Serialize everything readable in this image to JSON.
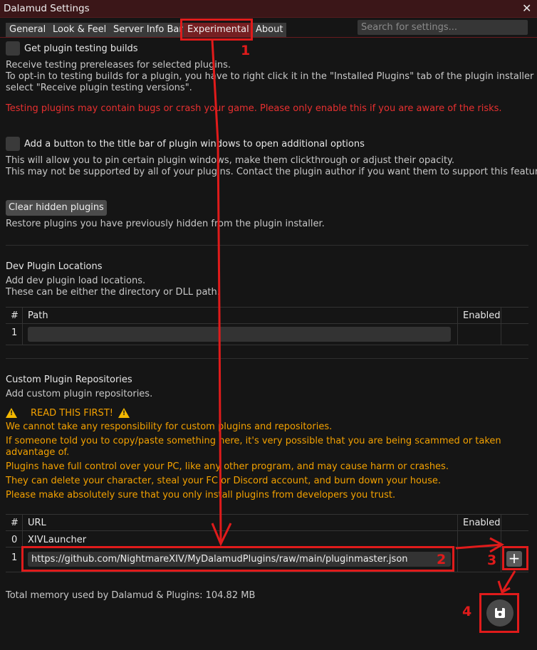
{
  "window": {
    "title": "Dalamud Settings",
    "close_symbol": "✕"
  },
  "tabs": [
    {
      "label": "General"
    },
    {
      "label": "Look & Feel"
    },
    {
      "label": "Server Info Bar"
    },
    {
      "label": "Experimental"
    },
    {
      "label": "About"
    }
  ],
  "search": {
    "placeholder": "Search for settings..."
  },
  "testing_builds": {
    "label": "Get plugin testing builds",
    "desc1": "Receive testing prereleases for selected plugins.",
    "desc2": "To opt-in to testing builds for a plugin, you have to right click it in the \"Installed Plugins\" tab of the plugin installer and",
    "desc3": "select \"Receive plugin testing versions\".",
    "warning": "Testing plugins may contain bugs or crash your game. Please only enable this if you are aware of the risks."
  },
  "title_bar_button": {
    "label": "Add a button to the title bar of plugin windows to open additional options",
    "desc1": "This will allow you to pin certain plugin windows, make them clickthrough or adjust their opacity.",
    "desc2": "This may not be supported by all of your plugins. Contact the plugin author if you want them to support this feature."
  },
  "hidden_plugins": {
    "button_label": "Clear hidden plugins",
    "desc": "Restore plugins you have previously hidden from the plugin installer."
  },
  "dev_plugins": {
    "heading": "Dev Plugin Locations",
    "desc1": "Add dev plugin load locations.",
    "desc2": "These can be either the directory or DLL path.",
    "columns": [
      "#",
      "Path",
      "Enabled"
    ],
    "rows": [
      {
        "index": "1",
        "path": ""
      }
    ]
  },
  "custom_repos": {
    "heading": "Custom Plugin Repositories",
    "desc": "Add custom plugin repositories.",
    "warning_title": "READ THIS FIRST!",
    "warnings": [
      "We cannot take any responsibility for custom plugins and repositories.",
      "If someone told you to copy/paste something here, it's very possible that you are being scammed or taken advantage of.",
      "Plugins have full control over your PC, like any other program, and may cause harm or crashes.",
      "They can delete your character, steal your FC or Discord account, and burn down your house.",
      "Please make absolutely sure that you only install plugins from developers you trust."
    ],
    "columns": [
      "#",
      "URL",
      "Enabled"
    ],
    "rows": [
      {
        "index": "0",
        "url": "XIVLauncher"
      },
      {
        "index": "1",
        "url": "https://github.com/NightmareXIV/MyDalamudPlugins/raw/main/pluginmaster.json"
      }
    ],
    "add_symbol": "+"
  },
  "footer": {
    "memory_text": "Total memory used by Dalamud & Plugins: 104.82 MB"
  },
  "annotations": {
    "step1": "1",
    "step2": "2",
    "step3": "3",
    "step4": "4",
    "color": "#e01b1b"
  },
  "colors": {
    "active_tab": "#751f22",
    "titlebar": "#3b1618",
    "warning_red": "#e83030",
    "warning_orange": "#f3a100"
  }
}
